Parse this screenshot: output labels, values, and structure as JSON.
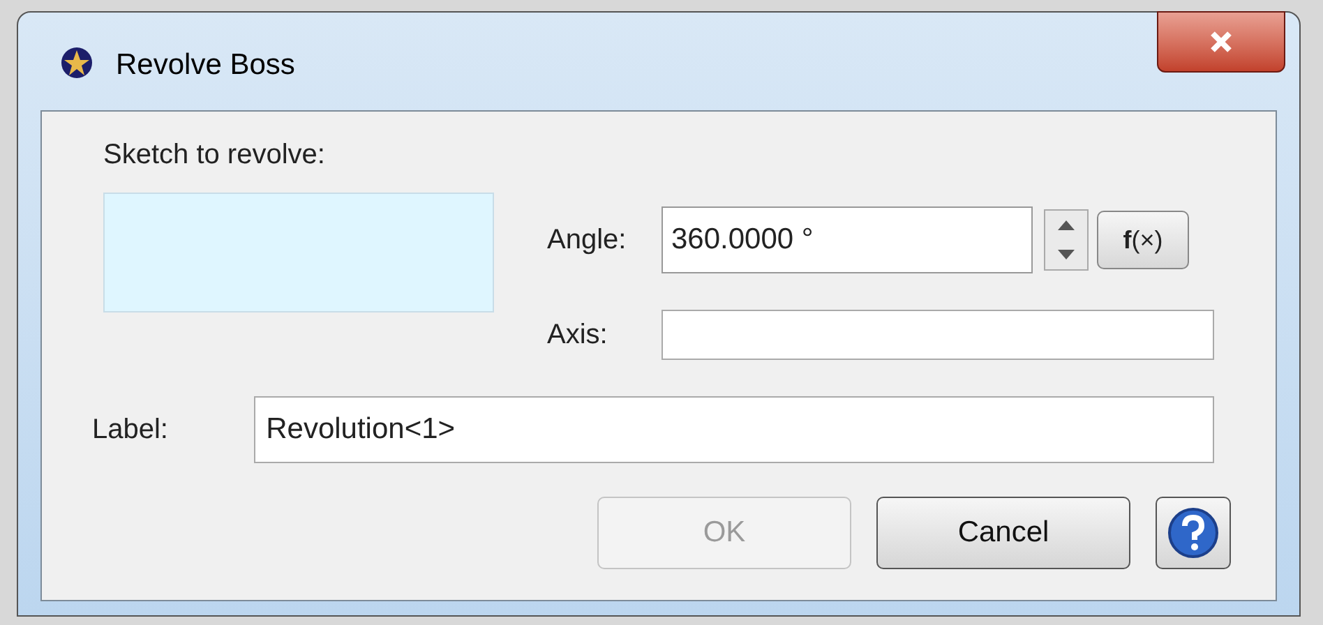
{
  "window": {
    "title": "Revolve Boss"
  },
  "sketch": {
    "label": "Sketch to revolve:"
  },
  "angle": {
    "label": "Angle:",
    "value": "360.0000 °",
    "formula_button": "**f**(×)"
  },
  "axis": {
    "label": "Axis:"
  },
  "name": {
    "label": "Label:",
    "value": "Revolution<1>"
  },
  "buttons": [
    {
      "kind": "text",
      "label": "OK",
      "disabled": true
    },
    {
      "kind": "text",
      "label": "Cancel",
      "disabled": false
    },
    {
      "kind": "help",
      "disabled": false
    }
  ]
}
